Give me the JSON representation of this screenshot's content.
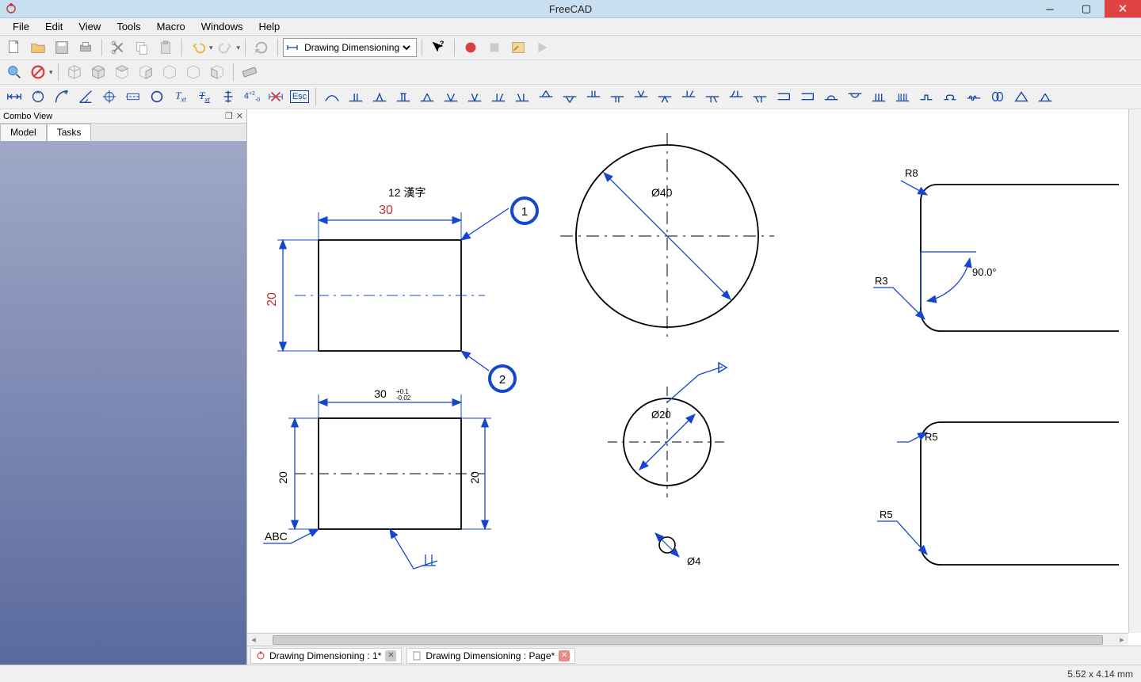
{
  "app_title": "FreeCAD",
  "menu": [
    "File",
    "Edit",
    "View",
    "Tools",
    "Macro",
    "Windows",
    "Help"
  ],
  "workbench": {
    "selected": "Drawing Dimensioning"
  },
  "combo": {
    "title": "Combo View",
    "tabs": {
      "tab0": "Model",
      "tab1": "Tasks"
    }
  },
  "doc_tabs": {
    "tab0": "Drawing Dimensioning : 1*",
    "tab1": "Drawing Dimensioning : Page*"
  },
  "status": {
    "coords": "5.52 x 4.14 mm"
  },
  "drawing": {
    "note_top": "12  漢字",
    "dim_30": "30",
    "dim_20": "20",
    "dim_30_tol": "30",
    "tol_plus": "+0.1",
    "tol_minus": "-0.02",
    "dim_20_l": "20",
    "dim_20_r": "20",
    "abc": "ABC",
    "balloon1": "1",
    "balloon2": "2",
    "dia40": "Ø40",
    "dia20": "Ø20",
    "dia4": "Ø4",
    "r8": "R8",
    "r3": "R3",
    "r5a": "R5",
    "r5b": "R5",
    "ang90": "90.0°"
  }
}
